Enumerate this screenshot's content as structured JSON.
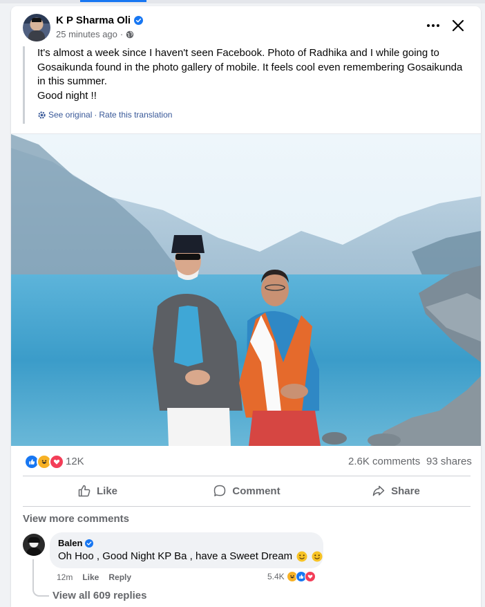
{
  "post": {
    "author": "K P Sharma Oli",
    "time": "25 minutes ago",
    "text_lines": [
      "It's almost a week since I haven't seen Facebook. Photo of Radhika and I while going to",
      "Gosaikunda found in the photo gallery of mobile. It feels cool even remembering Gosaikunda",
      "in this summer.",
      "Good night !!"
    ],
    "translation": {
      "see_original": "See original",
      "separator": "·",
      "rate": "Rate this translation"
    }
  },
  "stats": {
    "reaction_count": "12K",
    "comments": "2.6K comments",
    "shares": "93 shares"
  },
  "actions": {
    "like": "Like",
    "comment": "Comment",
    "share": "Share"
  },
  "comments_section": {
    "view_more": "View more comments",
    "comment": {
      "author": "Balen",
      "text": "Oh Hoo , Good Night KP Ba , have a Sweet Dream",
      "time": "12m",
      "like": "Like",
      "reply": "Reply",
      "reaction_count": "5.4K"
    },
    "view_replies": "View all 609 replies"
  },
  "colors": {
    "brand_blue": "#1877f2",
    "love_red": "#f33e58",
    "haha_yellow": "#f7b125",
    "secondary_text": "#65676b"
  },
  "icons": [
    "verified-icon",
    "globe-icon",
    "more-icon",
    "close-icon",
    "gear-icon",
    "like-icon",
    "comment-icon",
    "share-icon",
    "like-reaction-icon",
    "haha-reaction-icon",
    "love-reaction-icon",
    "smiley-icon"
  ]
}
